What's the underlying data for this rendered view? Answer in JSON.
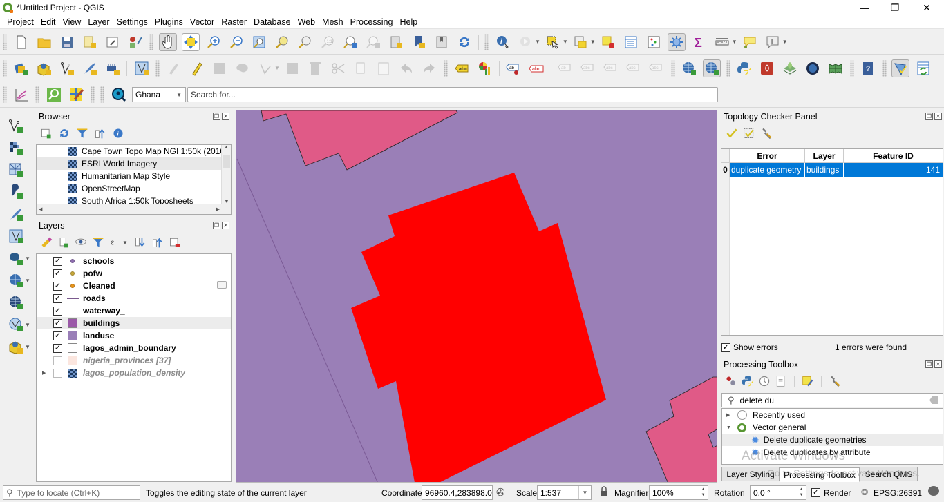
{
  "window": {
    "title": "*Untitled Project - QGIS",
    "controls": {
      "minimize": "—",
      "maximize": "❐",
      "close": "✕"
    }
  },
  "menu": [
    "Project",
    "Edit",
    "View",
    "Layer",
    "Settings",
    "Plugins",
    "Vector",
    "Raster",
    "Database",
    "Web",
    "Mesh",
    "Processing",
    "Help"
  ],
  "toolbar3": {
    "locator_country": "Ghana",
    "search_placeholder": "Search for..."
  },
  "browser": {
    "title": "Browser",
    "items": [
      "Cape Town Topo Map NGI 1:50k (2010",
      "ESRI World Imagery",
      "Humanitarian Map Style",
      "OpenStreetMap",
      "South Africa 1:50k Toposheets"
    ],
    "selected_index": 1
  },
  "layers": {
    "title": "Layers",
    "items": [
      {
        "name": "schools",
        "checked": true,
        "symbol": "point",
        "color": "#8e6db0",
        "bold": true
      },
      {
        "name": "pofw",
        "checked": true,
        "symbol": "point",
        "color": "#c8a83a",
        "bold": true
      },
      {
        "name": "Cleaned",
        "checked": true,
        "symbol": "point",
        "color": "#e8941a",
        "bold": true
      },
      {
        "name": "roads_",
        "checked": true,
        "symbol": "line",
        "color": "#7a5a8e",
        "bold": true
      },
      {
        "name": "waterway_",
        "checked": true,
        "symbol": "line",
        "color": "#7ab070",
        "bold": true
      },
      {
        "name": "buildings",
        "checked": true,
        "symbol": "fill",
        "color": "#9b59a8",
        "bold": true,
        "selected": true
      },
      {
        "name": "landuse",
        "checked": true,
        "symbol": "fill",
        "color": "#9a7fb8",
        "bold": true
      },
      {
        "name": "lagos_admin_boundary",
        "checked": true,
        "symbol": "fill",
        "color": "#ffffff",
        "bold": true
      },
      {
        "name": "nigeria_provinces [37]",
        "checked": false,
        "symbol": "fill",
        "color": "#fbe6df",
        "italic": true
      },
      {
        "name": "lagos_population_density",
        "checked": false,
        "symbol": "raster",
        "italic": true,
        "expandable": true
      }
    ]
  },
  "map": {
    "background": "#9a7fb7",
    "building_color": "#e05a87",
    "highlight_color": "#ff0000"
  },
  "topology": {
    "title": "Topology Checker Panel",
    "columns": [
      "Error",
      "Layer",
      "Feature ID"
    ],
    "rows": [
      {
        "index": "0",
        "error": "duplicate geometry",
        "layer": "buildings",
        "feature_id": "141"
      }
    ],
    "show_errors_label": "Show errors",
    "show_errors_checked": true,
    "status": "1 errors were found"
  },
  "processing": {
    "title": "Processing Toolbox",
    "search_value": "delete du",
    "tree": [
      {
        "label": "Recently used",
        "level": 0,
        "expanded": false,
        "icon": "clock-icon"
      },
      {
        "label": "Vector general",
        "level": 0,
        "expanded": true,
        "icon": "qgis-icon"
      },
      {
        "label": "Delete duplicate geometries",
        "level": 1,
        "icon": "gear-icon",
        "highlighted": true
      },
      {
        "label": "Delete duplicates by attribute",
        "level": 1,
        "icon": "gear-icon"
      }
    ],
    "watermark_line1": "Activate Windows",
    "watermark_line2": "Go to Settings to activate Windows."
  },
  "dock_tabs": [
    "Layer Styling",
    "Processing Toolbox",
    "Search QMS"
  ],
  "dock_tab_active": 1,
  "status": {
    "locate_placeholder": "Type to locate (Ctrl+K)",
    "message": "Toggles the editing state of the current layer",
    "coordinate_label": "Coordinate",
    "coordinate_value": "96960.4,283898.0",
    "scale_label": "Scale",
    "scale_value": "1:537",
    "magnifier_label": "Magnifier",
    "magnifier_value": "100%",
    "rotation_label": "Rotation",
    "rotation_value": "0.0 °",
    "render_label": "Render",
    "render_checked": true,
    "crs": "EPSG:26391"
  }
}
